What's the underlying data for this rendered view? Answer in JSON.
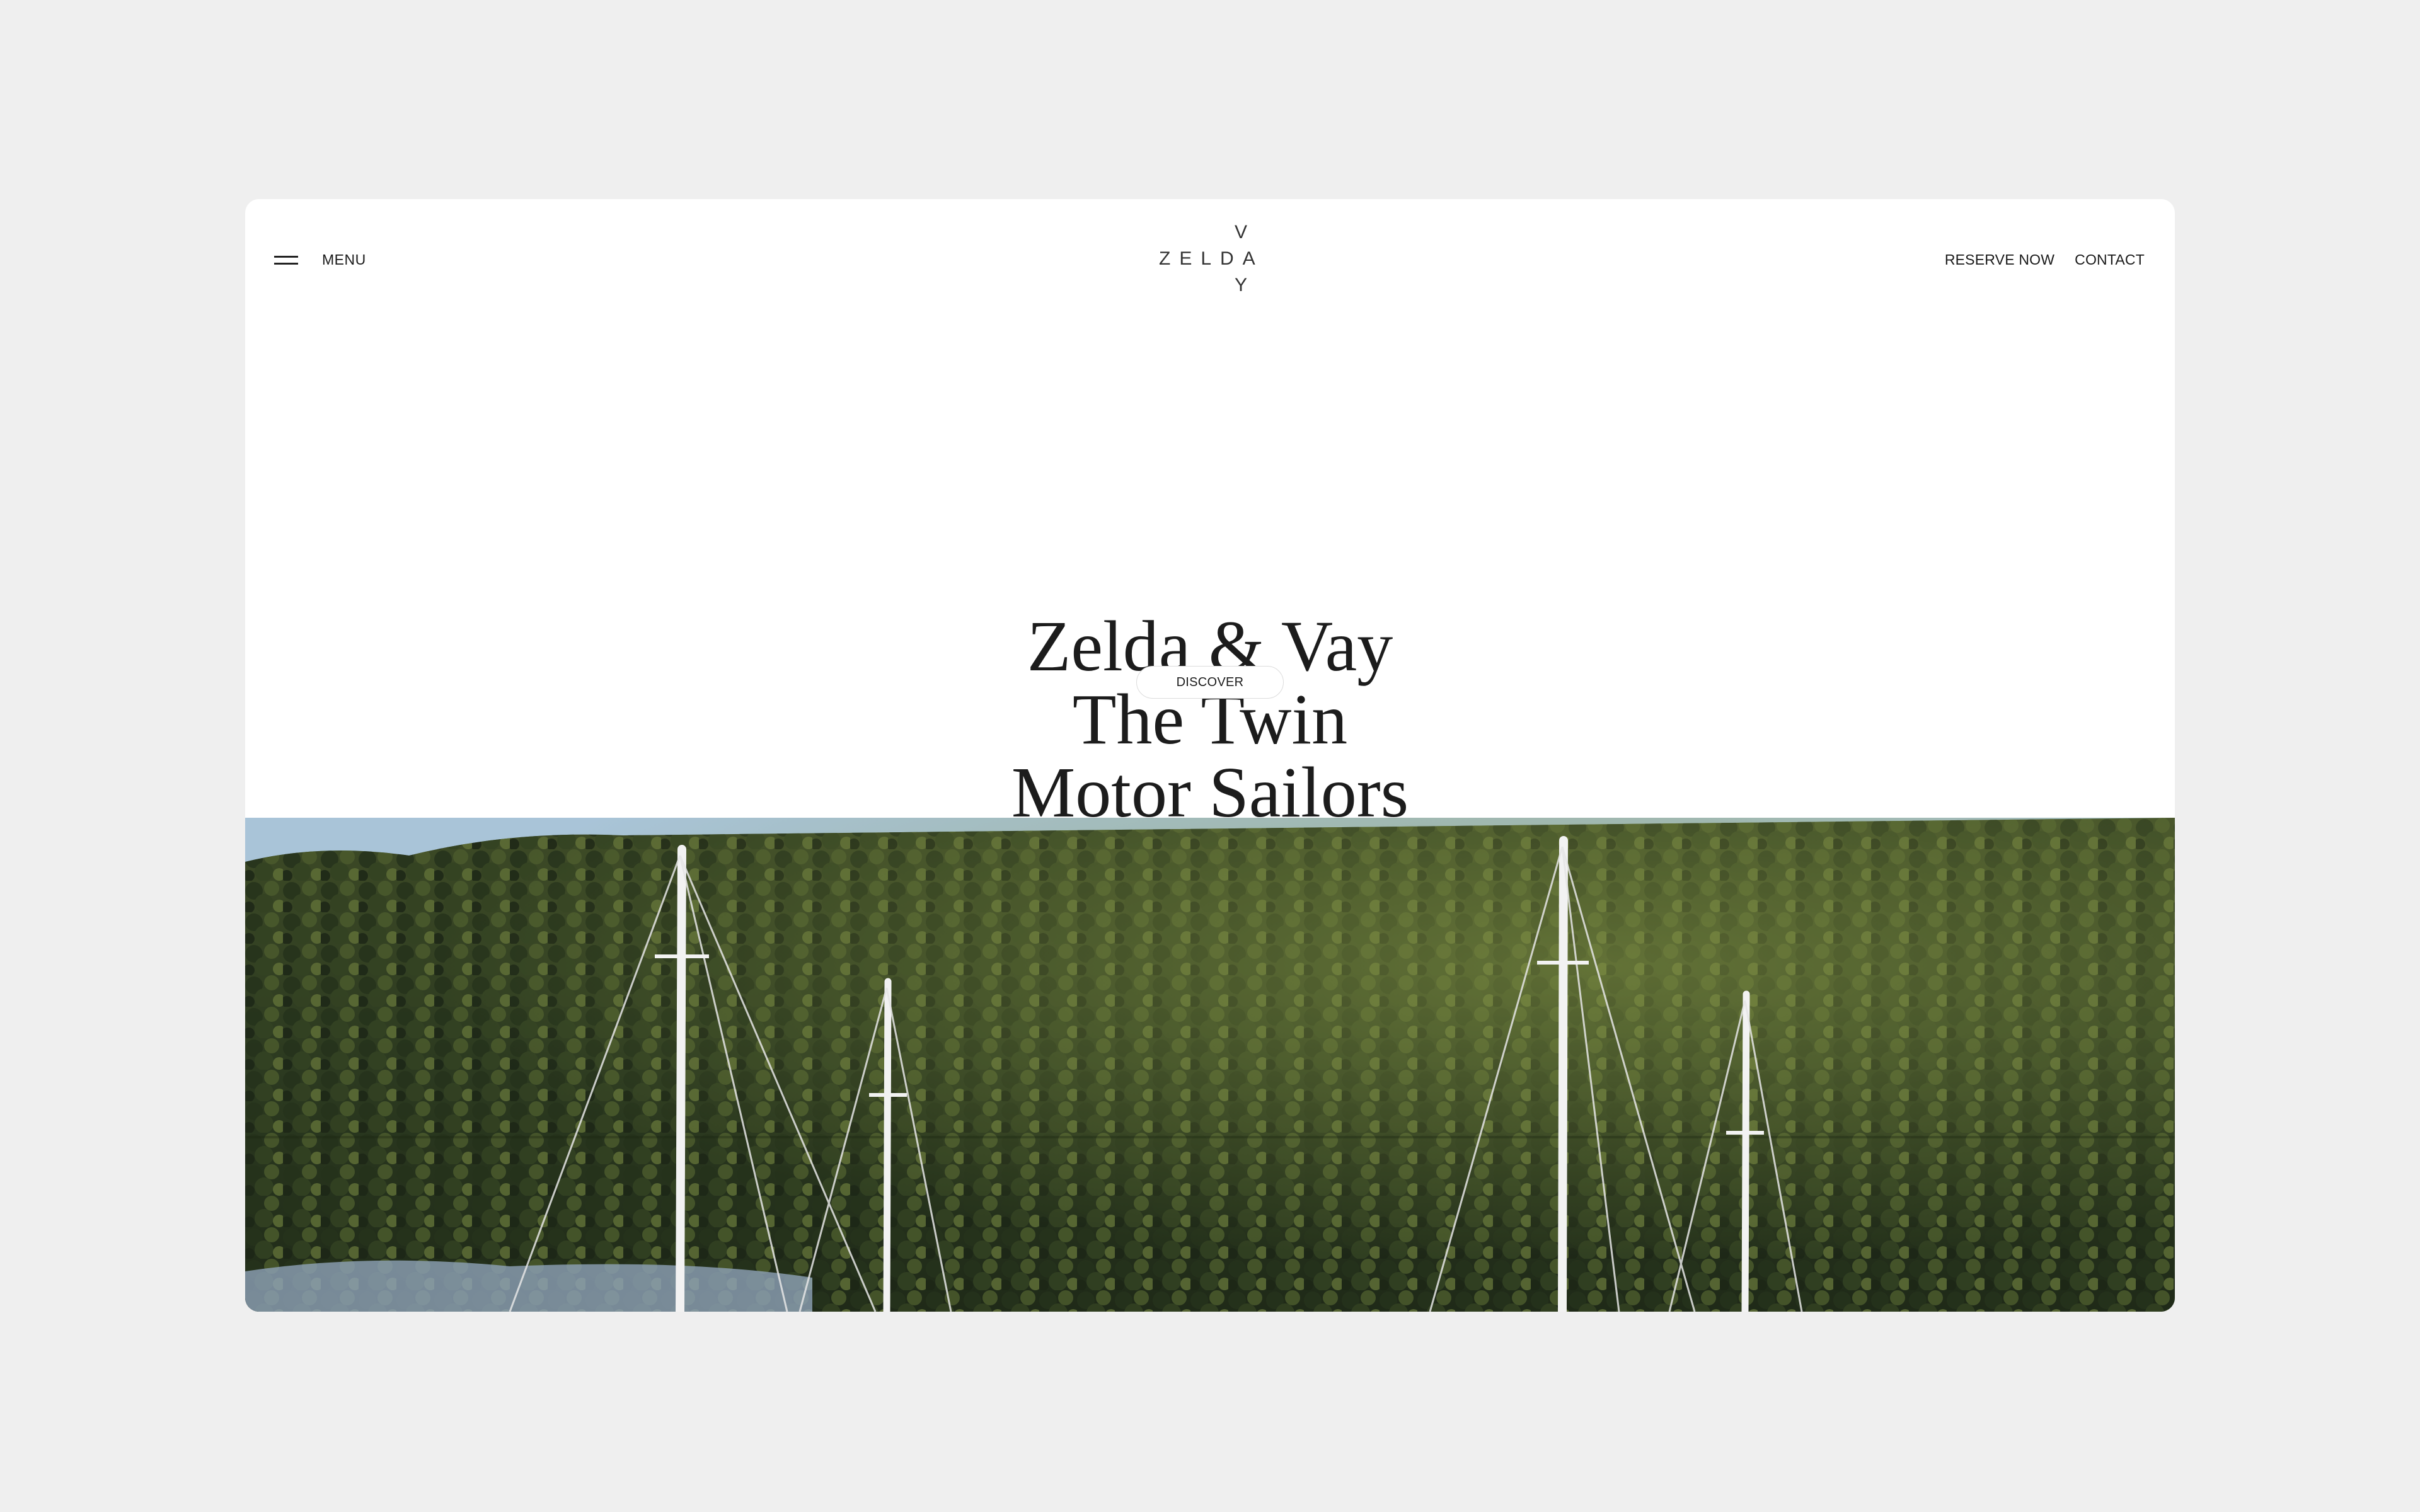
{
  "header": {
    "menu_label": "MENU",
    "logo": {
      "word": "ZELDA",
      "vertical_top": "V",
      "vertical_mid": "Λ",
      "vertical_bottom": "Y"
    },
    "nav": {
      "reserve_label": "RESERVE NOW",
      "contact_label": "CONTACT"
    }
  },
  "hero": {
    "title_line1": "Zelda & Vay",
    "title_line2": "The Twin",
    "title_line3": "Motor Sailors",
    "discover_label": "DISCOVER"
  },
  "colors": {
    "page_background": "#efefef",
    "card_background": "#ffffff",
    "text": "#1c1c1c",
    "foliage_dark": "#2a3520",
    "foliage_light": "#7c8a3e",
    "sky": "#a9c4d8"
  },
  "icons": {
    "menu": "hamburger-icon"
  },
  "image": {
    "subject": "sailboat masts against forested hillside"
  }
}
